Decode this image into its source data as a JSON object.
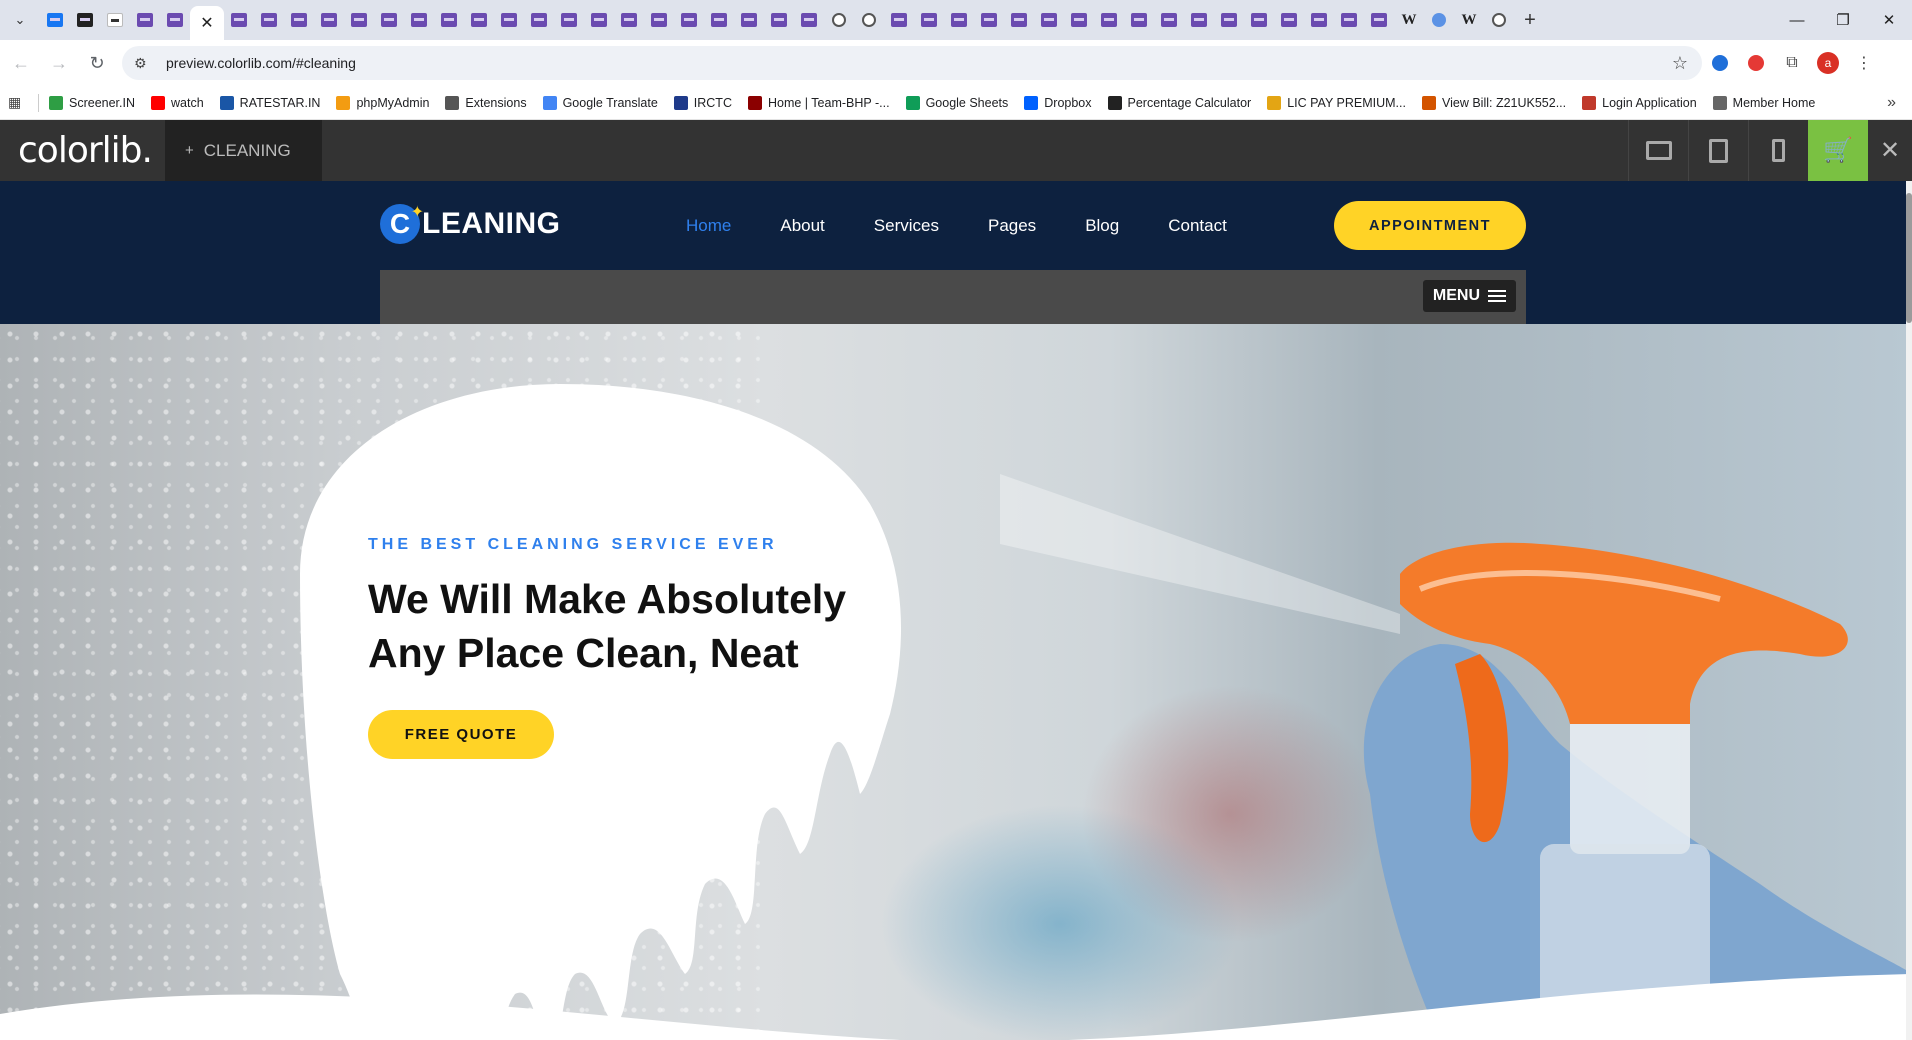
{
  "browser": {
    "tab_search_glyph": "⌄",
    "new_tab_glyph": "+",
    "window": {
      "minimize": "—",
      "restore": "❐",
      "close": "✕"
    },
    "url": "preview.colorlib.com/#cleaning",
    "profile_initial": "a"
  },
  "bookmarks": [
    {
      "label": "Screener.IN",
      "color": "#2e9e44"
    },
    {
      "label": "watch",
      "color": "#ff0000"
    },
    {
      "label": "RATESTAR.IN",
      "color": "#1a56a6"
    },
    {
      "label": "phpMyAdmin",
      "color": "#f39c12"
    },
    {
      "label": "Extensions",
      "color": "#555555"
    },
    {
      "label": "Google Translate",
      "color": "#4285f4"
    },
    {
      "label": "IRCTC",
      "color": "#1e3a8a"
    },
    {
      "label": "Home | Team-BHP -...",
      "color": "#8b0000"
    },
    {
      "label": "Google Sheets",
      "color": "#0f9d58"
    },
    {
      "label": "Dropbox",
      "color": "#0061fe"
    },
    {
      "label": "Percentage Calculator",
      "color": "#222222"
    },
    {
      "label": "LIC PAY PREMIUM...",
      "color": "#e3a514"
    },
    {
      "label": "View Bill: Z21UK552...",
      "color": "#d35400"
    },
    {
      "label": "Login Application",
      "color": "#c0392b"
    },
    {
      "label": "Member Home",
      "color": "#666666"
    }
  ],
  "colorlib": {
    "logo": "colorlib.",
    "theme_plus": "+",
    "theme_name": "CLEANING",
    "cart_glyph": "🛒",
    "close_glyph": "✕"
  },
  "site": {
    "logo_letter": "C",
    "logo_word": "LEANING",
    "nav": [
      "Home",
      "About",
      "Services",
      "Pages",
      "Blog",
      "Contact"
    ],
    "appointment": "APPOINTMENT",
    "menu": "MENU"
  },
  "hero": {
    "kicker": "THE BEST CLEANING SERVICE EVER",
    "title_line1": "We Will Make Absolutely",
    "title_line2": "Any Place Clean, Neat",
    "quote_button": "FREE QUOTE"
  },
  "colors": {
    "header_bg": "#0d213f",
    "accent_yellow": "#ffd326",
    "accent_blue": "#2f80ed",
    "cart_green": "#7ac142"
  }
}
